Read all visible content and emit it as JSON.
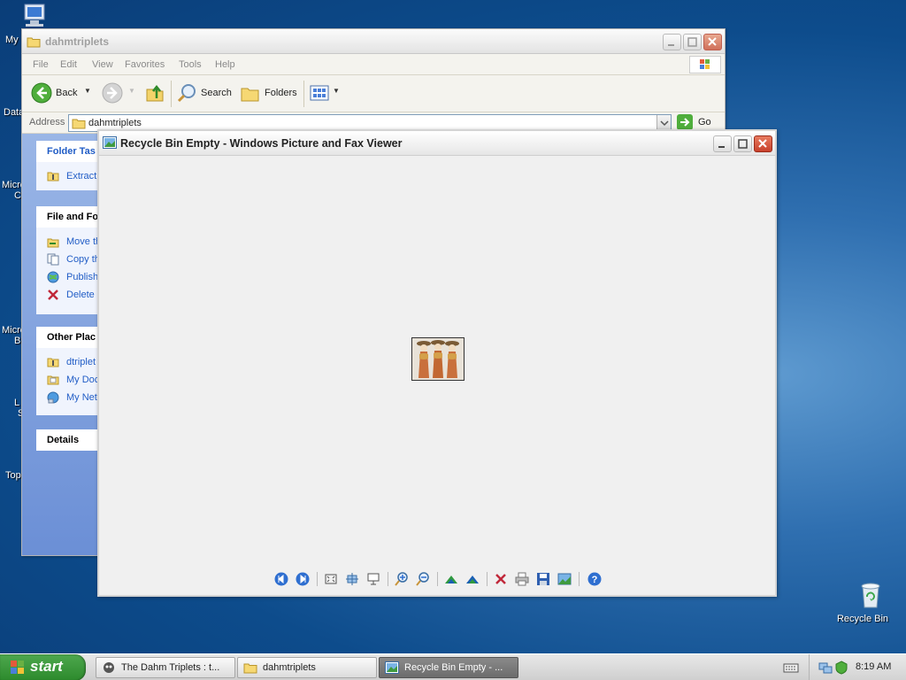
{
  "desktop": {
    "left_labels": [
      "My",
      "Data",
      "Micro",
      "C",
      "Micro",
      "B",
      "L",
      "S",
      "Top"
    ],
    "recycle_bin_label": "Recycle Bin"
  },
  "explorer": {
    "title": "dahmtriplets",
    "menu": [
      "File",
      "Edit",
      "View",
      "Favorites",
      "Tools",
      "Help"
    ],
    "toolbar": {
      "back": "Back",
      "search": "Search",
      "folders": "Folders"
    },
    "address_label": "Address",
    "address_value": "dahmtriplets",
    "go_label": "Go",
    "task_pane": {
      "folder_tasks": {
        "title": "Folder Tas",
        "items": [
          "Extract"
        ]
      },
      "file_folder_tasks": {
        "title": "File and Fo",
        "items": [
          "Move th",
          "Copy th",
          "Publish",
          "Delete"
        ]
      },
      "other_places": {
        "title": "Other Plac",
        "items": [
          "dtriplet",
          "My Doc",
          "My Net"
        ]
      },
      "details": {
        "title": "Details"
      }
    }
  },
  "viewer": {
    "title": "Recycle Bin Empty - Windows Picture and Fax Viewer"
  },
  "taskbar": {
    "start_label": "start",
    "tasks": [
      {
        "label": "The Dahm Triplets : t...",
        "active": false
      },
      {
        "label": "dahmtriplets",
        "active": false
      },
      {
        "label": "Recycle Bin Empty - ...",
        "active": true
      }
    ],
    "clock": "8:19 AM"
  }
}
